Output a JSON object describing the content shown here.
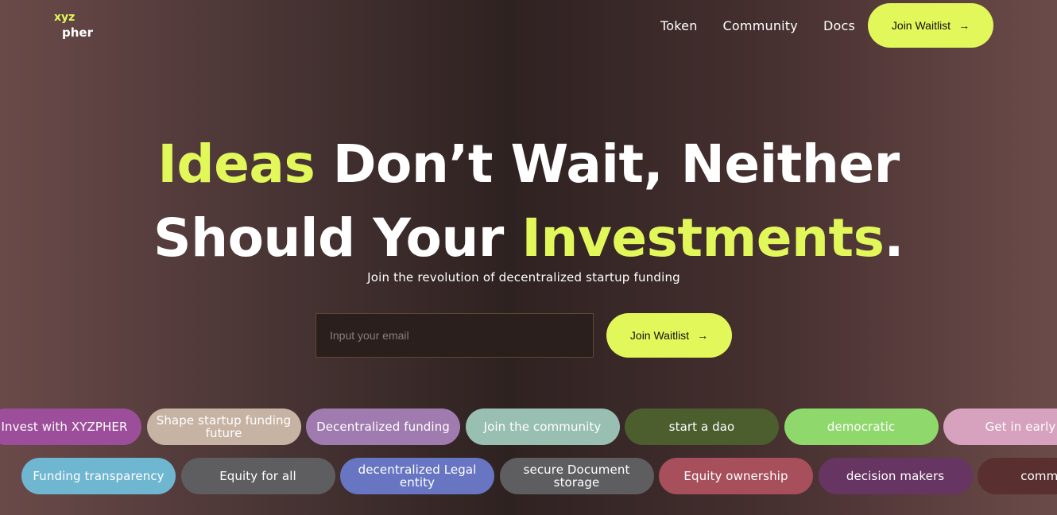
{
  "logo": {
    "line1": "xyz",
    "line2": "pher"
  },
  "nav": {
    "links": [
      "Token",
      "Community",
      "Docs"
    ],
    "cta": "Join Waitlist"
  },
  "hero": {
    "word1": "Ideas",
    "mid": " Don’t Wait, Neither",
    "line2_start": "Should Your ",
    "word2": "Investments",
    "period": ".",
    "subtitle": "Join the revolution of decentralized startup funding"
  },
  "form": {
    "placeholder": "Input your email",
    "cta": "Join Waitlist"
  },
  "colors": {
    "accent": "#e2f85a"
  },
  "icons": {
    "arrow": "arrow-right-icon"
  },
  "tags_row1": [
    {
      "label": "Invest with XYZPHER",
      "color": "#9c4e9a"
    },
    {
      "label": "Shape startup funding future",
      "color": "#c7b3a3"
    },
    {
      "label": "Decentralized funding",
      "color": "#a07bb0"
    },
    {
      "label": "Join the community",
      "color": "#98bfb2"
    },
    {
      "label": "start a dao",
      "color": "#4c5e2e"
    },
    {
      "label": "democratic",
      "color": "#8fd96c"
    },
    {
      "label": "Get in early",
      "color": "#d6a2bd"
    }
  ],
  "tags_row2": [
    {
      "label": "Funding transparency",
      "color": "#6fb6d1"
    },
    {
      "label": "Equity for all",
      "color": "#5e5e60"
    },
    {
      "label": "decentralized Legal entity",
      "color": "#6775c2"
    },
    {
      "label": "secure Document storage",
      "color": "#5e5e60"
    },
    {
      "label": "Equity ownership",
      "color": "#a84f5c"
    },
    {
      "label": "decision makers",
      "color": "#663562"
    },
    {
      "label": "community",
      "color": "#5a2f30"
    }
  ]
}
